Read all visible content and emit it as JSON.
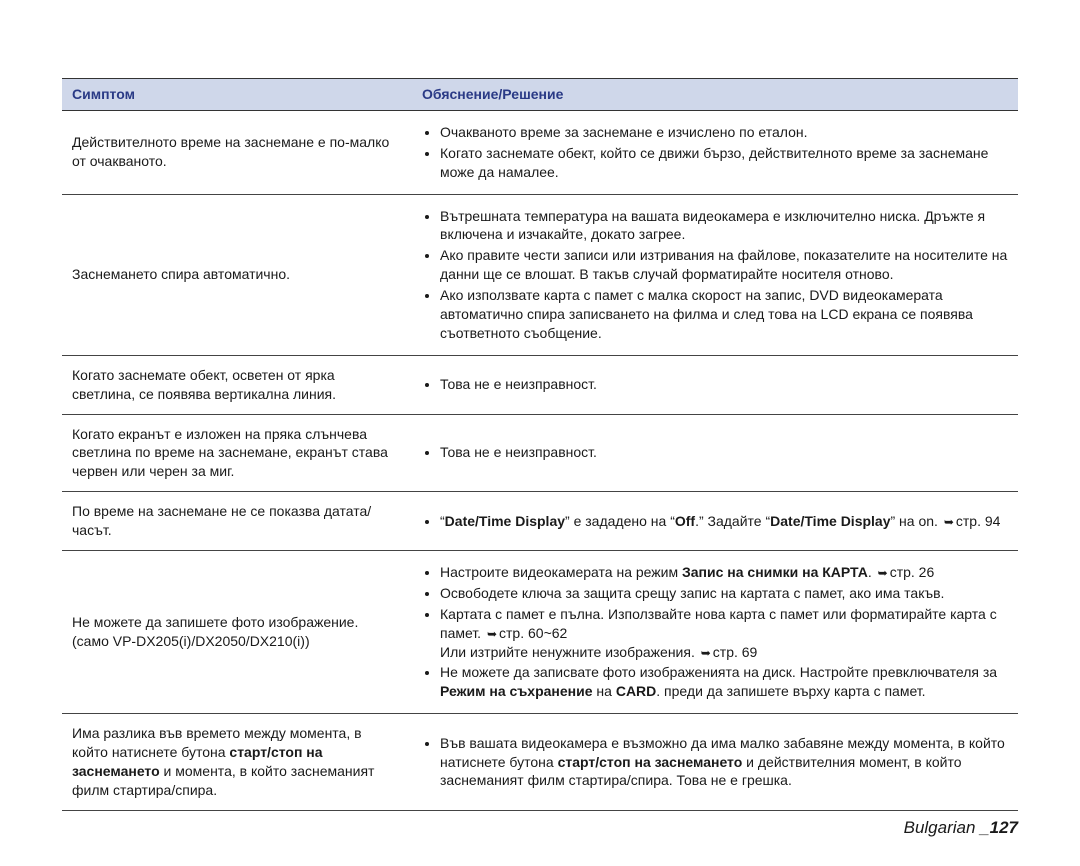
{
  "header": {
    "col1": "Симптом",
    "col2": "Обяснение/Решение"
  },
  "rows": [
    {
      "symptom": "Действителното време на заснемане е по-малко от очакваното.",
      "solutions": [
        {
          "text": "Очакваното време за заснемане е изчислено по еталон."
        },
        {
          "text": "Когато заснемате обект, който се движи бързо, действителното време за заснемане може да намалее."
        }
      ]
    },
    {
      "symptom": "Заснемането спира автоматично.",
      "solutions": [
        {
          "text": "Вътрешната температура на вашата видеокамера е изключително ниска. Дръжте я включена и изчакайте, докато загрее."
        },
        {
          "text": "Ако правите чести записи или изтривания на файлове, показателите на носителите на данни ще се влошат. В такъв случай форматирайте носителя отново."
        },
        {
          "text": "Ако използвате карта с памет с малка скорост на запис, DVD видеокамерата автоматично спира записването на филма и след това на LCD екрана се появява съответното съобщение."
        }
      ]
    },
    {
      "symptom": "Когато заснемате обект, осветен от ярка светлина, се появява вертикална линия.",
      "solutions": [
        {
          "text": "Това не е неизправност."
        }
      ]
    },
    {
      "symptom": "Когато екранът е изложен на пряка слънчева светлина по време на заснемане, екранът става червен или черен за миг.",
      "solutions": [
        {
          "text": "Това не е неизправност."
        }
      ]
    },
    {
      "symptom": "По време на заснемане не се показва датата/часът.",
      "solutions": [
        {
          "html": "“<span class=\"b\">Date/Time Display</span>” е зададено на “<span class=\"b\">Off</span>.” Задайте “<span class=\"b\">Date/Time Display</span>” на on. <span class=\"arrow\"></span>стр. 94"
        }
      ]
    },
    {
      "symptom": "Не можете да запишете фото изображение. (само VP-DX205(i)/DX2050/DX210(i))",
      "solutions": [
        {
          "html": "Настроите видеокамерата на режим <span class=\"b\">Запис на снимки на КАРТА</span>. <span class=\"arrow\"></span>стр. 26"
        },
        {
          "text": "Освободете ключа за защита срещу запис на картата с памет, ако има такъв."
        },
        {
          "html": "Картата с памет е пълна. Използвайте нова карта с памет или форматирайте карта с памет. <span class=\"arrow\"></span>стр. 60~62<br>Или изтрийте ненужните изображения. <span class=\"arrow\"></span>стр. 69"
        },
        {
          "html": "Не можете да записвате фото изображенията на диск. Настройте превключвателя за <span class=\"b\">Режим на съхранение</span> на <span class=\"b\">CARD</span>. преди да запишете върху карта с памет."
        }
      ]
    },
    {
      "symptomHtml": "Има разлика във времето между момента, в който натиснете бутона <span class=\"b\">старт/стоп на заснемането</span> и момента, в който заснеманият филм стартира/спира.",
      "solutions": [
        {
          "html": "Във вашата видеокамера е възможно да има малко забавяне между момента, в който натиснете бутона <span class=\"b\">старт/стоп на заснемането</span> и действителния момент, в който заснеманият филм стартира/спира. Това не е грешка."
        }
      ]
    }
  ],
  "footer": {
    "lang": "Bulgarian _",
    "page": "127"
  }
}
